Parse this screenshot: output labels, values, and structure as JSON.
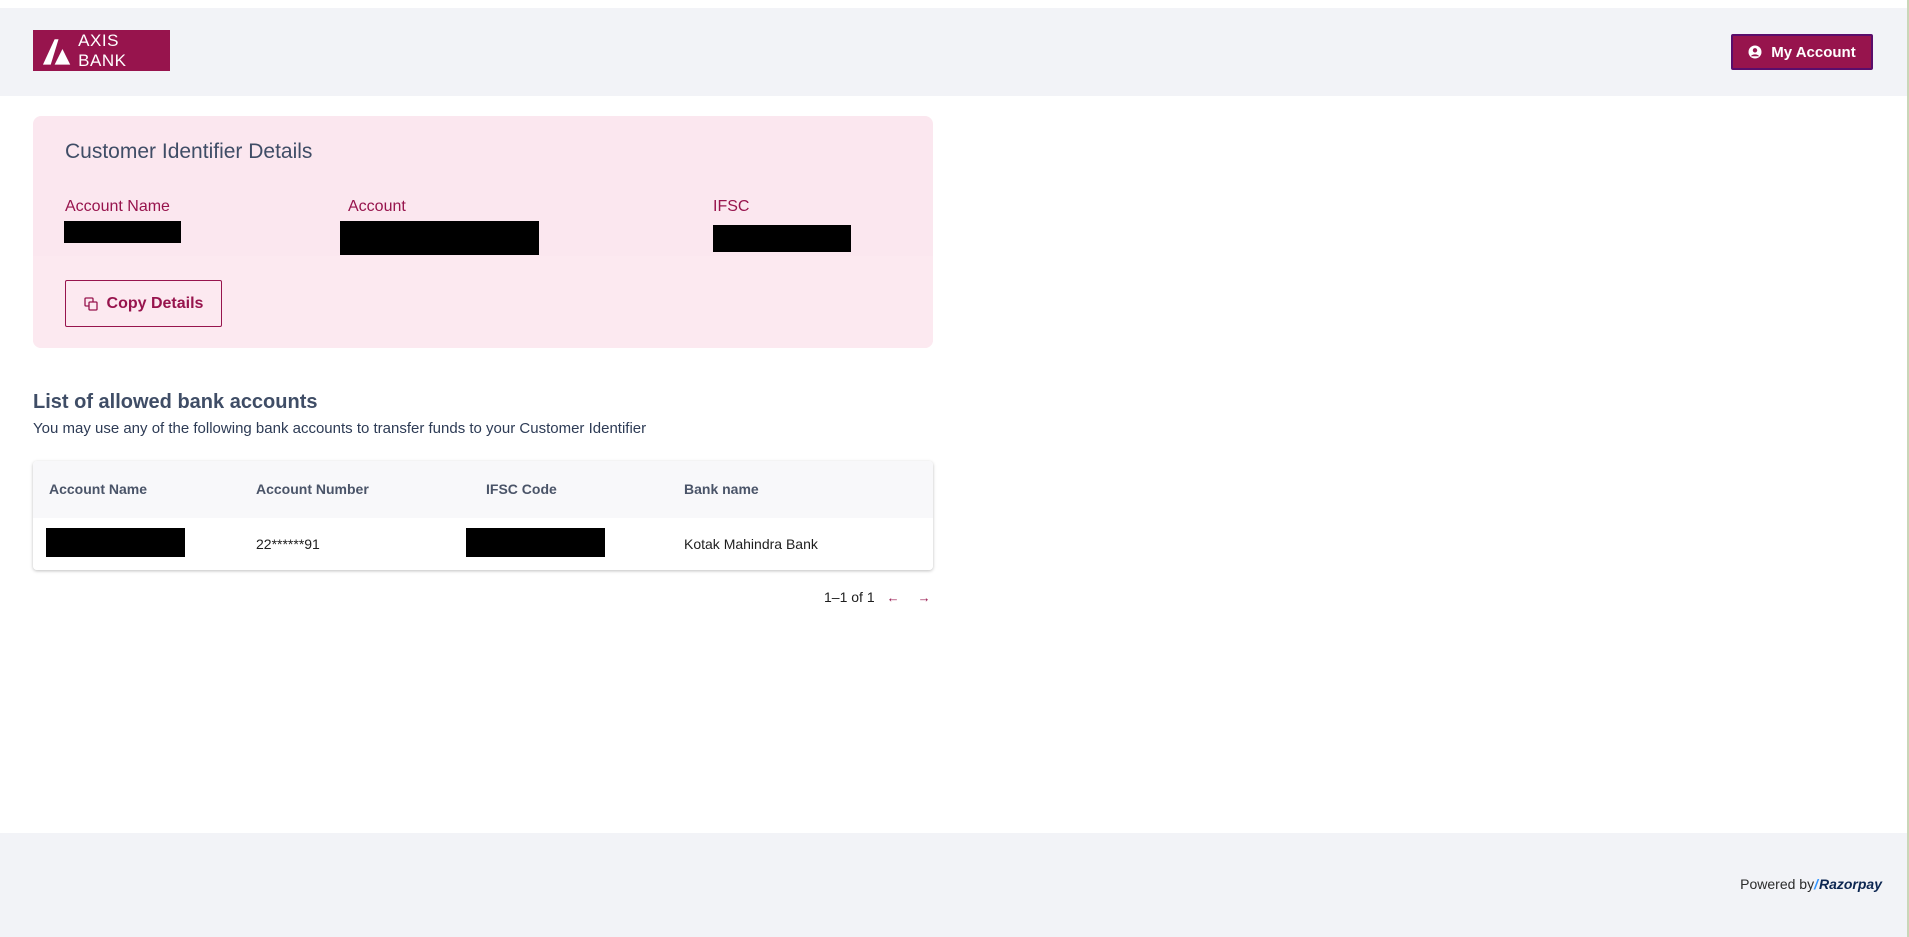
{
  "header": {
    "logo_text": "AXIS BANK",
    "my_account_label": "My Account"
  },
  "customer_identifier": {
    "title": "Customer Identifier Details",
    "fields": {
      "account_name_label": "Account Name",
      "account_label": "Account",
      "ifsc_label": "IFSC"
    },
    "copy_button_label": "Copy Details"
  },
  "allowed_accounts": {
    "title": "List of allowed bank accounts",
    "subtitle": "You may use any of the following bank accounts to transfer funds to your Customer Identifier",
    "columns": [
      "Account Name",
      "Account Number",
      "IFSC Code",
      "Bank name"
    ],
    "rows": [
      {
        "account_number": "22******91",
        "bank_name": "Kotak Mahindra Bank"
      }
    ],
    "pagination": "1–1 of 1",
    "prev_icon": "←",
    "next_icon": "→"
  },
  "footer": {
    "powered_by": "Powered by",
    "brand": "Razorpay"
  },
  "colors": {
    "brand": "#97144d",
    "card_bg": "#fbe7ef",
    "header_bg": "#f2f3f7"
  }
}
